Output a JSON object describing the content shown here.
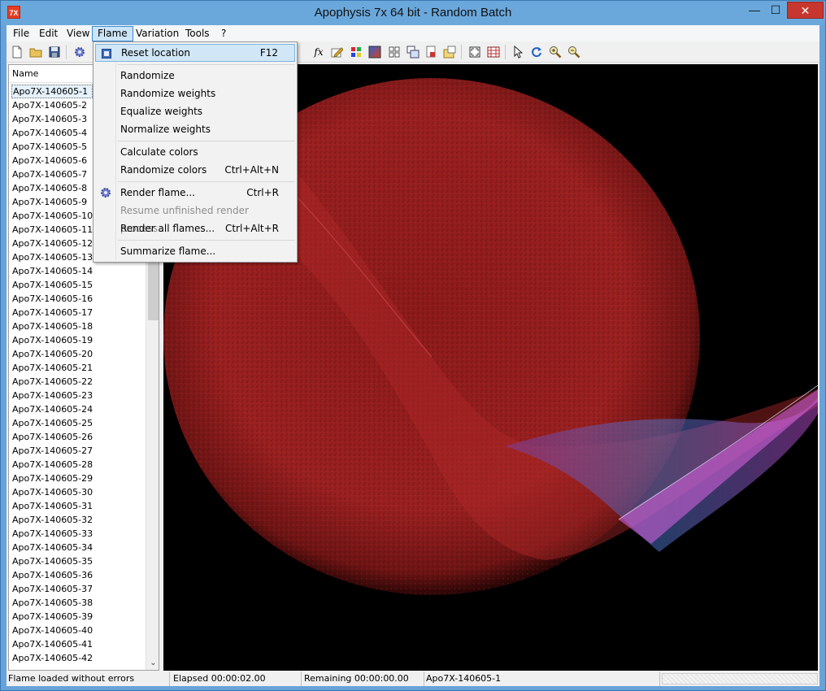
{
  "window": {
    "title": "Apophysis 7x 64 bit - Random Batch",
    "app_icon_text": "7X",
    "minimize": "—",
    "maximize": "☐",
    "close": "✕"
  },
  "menubar": {
    "items": [
      "File",
      "Edit",
      "View",
      "Flame",
      "Variation",
      "Tools",
      "?"
    ]
  },
  "toolbar": {
    "icons": [
      "new-icon",
      "open-icon",
      "save-icon",
      "render-gear-icon",
      "fx-icon",
      "edit-icon",
      "palette-icon",
      "gradient-icon",
      "mutate-icon",
      "grid-icon",
      "copy-icon",
      "script-icon",
      "options-icon",
      "fullscreen-icon",
      "transforms-icon",
      "select-icon",
      "rotate-icon",
      "zoom-in-icon",
      "zoom-out-icon"
    ],
    "fx_label": "fx"
  },
  "flame_list": {
    "header": "Name",
    "items": [
      "Apo7X-140605-1",
      "Apo7X-140605-2",
      "Apo7X-140605-3",
      "Apo7X-140605-4",
      "Apo7X-140605-5",
      "Apo7X-140605-6",
      "Apo7X-140605-7",
      "Apo7X-140605-8",
      "Apo7X-140605-9",
      "Apo7X-140605-10",
      "Apo7X-140605-11",
      "Apo7X-140605-12",
      "Apo7X-140605-13",
      "Apo7X-140605-14",
      "Apo7X-140605-15",
      "Apo7X-140605-16",
      "Apo7X-140605-17",
      "Apo7X-140605-18",
      "Apo7X-140605-19",
      "Apo7X-140605-20",
      "Apo7X-140605-21",
      "Apo7X-140605-22",
      "Apo7X-140605-23",
      "Apo7X-140605-24",
      "Apo7X-140605-25",
      "Apo7X-140605-26",
      "Apo7X-140605-27",
      "Apo7X-140605-28",
      "Apo7X-140605-29",
      "Apo7X-140605-30",
      "Apo7X-140605-31",
      "Apo7X-140605-32",
      "Apo7X-140605-33",
      "Apo7X-140605-34",
      "Apo7X-140605-35",
      "Apo7X-140605-36",
      "Apo7X-140605-37",
      "Apo7X-140605-38",
      "Apo7X-140605-39",
      "Apo7X-140605-40",
      "Apo7X-140605-41",
      "Apo7X-140605-42"
    ],
    "selected": "Apo7X-140605-1"
  },
  "flame_menu": {
    "items": [
      {
        "label": "Reset location",
        "shortcut": "F12",
        "icon": "reset-location-icon"
      },
      {
        "label": "Randomize",
        "shortcut": ""
      },
      {
        "label": "Randomize weights",
        "shortcut": ""
      },
      {
        "label": "Equalize weights",
        "shortcut": ""
      },
      {
        "label": "Normalize weights",
        "shortcut": ""
      },
      {
        "label": "Calculate colors",
        "shortcut": ""
      },
      {
        "label": "Randomize colors",
        "shortcut": "Ctrl+Alt+N"
      },
      {
        "label": "Render flame...",
        "shortcut": "Ctrl+R",
        "icon": "render-gear-icon"
      },
      {
        "label": "Resume unfinished render process...",
        "shortcut": "",
        "disabled": true
      },
      {
        "label": "Render all flames...",
        "shortcut": "Ctrl+Alt+R"
      },
      {
        "label": "Summarize flame...",
        "shortcut": ""
      }
    ]
  },
  "statusbar": {
    "message": "Flame loaded without errors",
    "elapsed": "Elapsed 00:00:02.00",
    "remaining": "Remaining 00:00:00.00",
    "flame_name": "Apo7X-140605-1"
  },
  "colors": {
    "titlebar": "#6aa8dc",
    "close_button": "#c7372f",
    "flame_red": "#a51d1d",
    "flame_blue": "#5b7fd6",
    "flame_magenta": "#c04bd0",
    "menu_highlight": "#d1e6f6"
  }
}
